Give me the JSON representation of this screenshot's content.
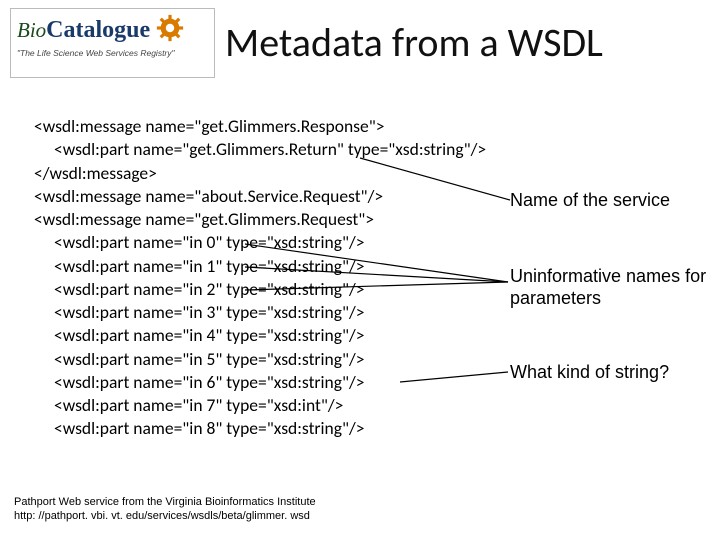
{
  "logo": {
    "bio": "Bio",
    "catalogue": "Catalogue",
    "tagline": "\"The Life Science Web Services Registry\""
  },
  "title": "Metadata from a WSDL",
  "code": {
    "l1": "<wsdl:message name=\"get.Glimmers.Response\">",
    "l2": "<wsdl:part name=\"get.Glimmers.Return\" type=\"xsd:string\"/>",
    "l3": "</wsdl:message>",
    "l4": "<wsdl:message name=\"about.Service.Request\"/>",
    "l5": "<wsdl:message name=\"get.Glimmers.Request\">",
    "l6": "<wsdl:part name=\"in 0\" type=\"xsd:string\"/>",
    "l7": "<wsdl:part name=\"in 1\" type=\"xsd:string\"/>",
    "l8": "<wsdl:part name=\"in 2\" type=\"xsd:string\"/>",
    "l9": "<wsdl:part name=\"in 3\" type=\"xsd:string\"/>",
    "l10": "<wsdl:part name=\"in 4\" type=\"xsd:string\"/>",
    "l11": "<wsdl:part name=\"in 5\" type=\"xsd:string\"/>",
    "l12": "<wsdl:part name=\"in 6\" type=\"xsd:string\"/>",
    "l13": "<wsdl:part name=\"in 7\" type=\"xsd:int\"/>",
    "l14": "<wsdl:part name=\"in 8\" type=\"xsd:string\"/>"
  },
  "annotations": {
    "a1": "Name of the service",
    "a2": "Uninformative names for parameters",
    "a3": "What kind of string?"
  },
  "footer": {
    "l1": "Pathport Web service from the Virginia Bioinformatics Institute",
    "l2": "http: //pathport. vbi. vt. edu/services/wsdls/beta/glimmer. wsd"
  }
}
